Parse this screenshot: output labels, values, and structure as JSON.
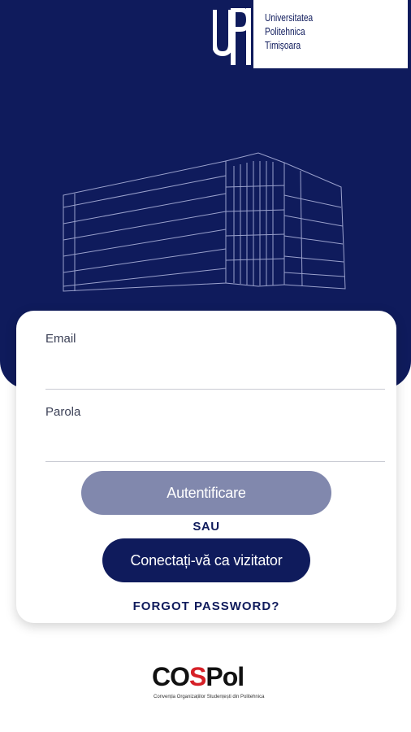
{
  "header": {
    "logo_mark": "UPT",
    "logo_lines": [
      "Universitatea",
      "Politehnica",
      "Timișoara"
    ]
  },
  "form": {
    "email_label": "Email",
    "email_value": "",
    "password_label": "Parola",
    "password_value": "",
    "login_button": "Autentificare",
    "separator": "SAU",
    "guest_button": "Conectați-vă ca vizitator",
    "forgot_link": "FORGOT PASSWORD?"
  },
  "footer": {
    "logo_prefix": "CO",
    "logo_accent": "S",
    "logo_suffix": "Pol",
    "tagline": "Convenția Organizațiilor Studențești din Politehnica"
  },
  "colors": {
    "brand_navy": "#0f1b5c",
    "button_disabled": "#8188ad",
    "accent_red": "#d62027"
  }
}
